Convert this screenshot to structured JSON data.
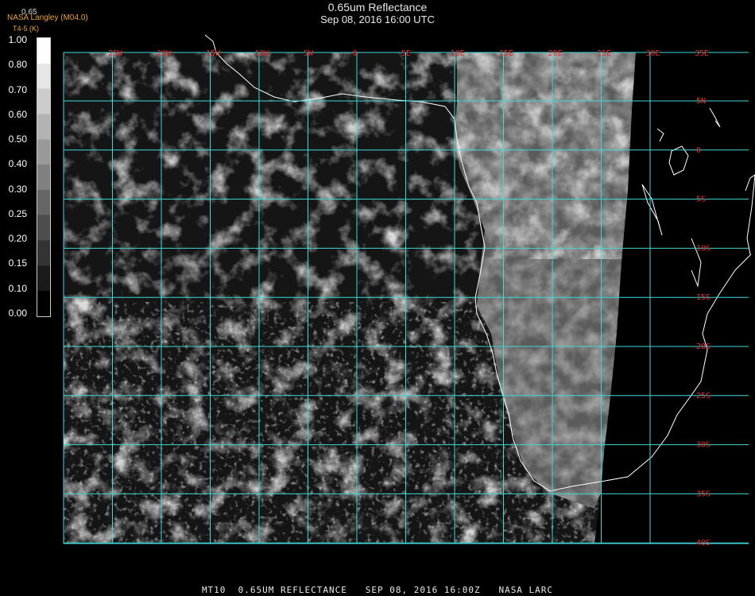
{
  "header": {
    "title": "0.65um Reflectance",
    "subtitle": "Sep 08, 2016 16:00 UTC",
    "brand": "NASA Langley (M04.0)",
    "brand_sub": "T4-5 (K)",
    "band_label": "0.65"
  },
  "colorbar": {
    "labels": [
      "1.00",
      "0.80",
      "0.70",
      "0.60",
      "0.50",
      "0.40",
      "0.30",
      "0.25",
      "0.20",
      "0.15",
      "0.10",
      "0.00"
    ]
  },
  "map": {
    "longitude_labels": [
      "25W",
      "20W",
      "15W",
      "10W",
      "5W",
      "0",
      "5E",
      "10E",
      "15E",
      "20E",
      "25E",
      "30E",
      "35E"
    ],
    "latitude_labels": [
      "5N",
      "0",
      "5S",
      "10S",
      "15S",
      "20S",
      "25S",
      "30S",
      "35S",
      "40S"
    ],
    "grid_color": "#40d8d8",
    "label_color": "#e03030"
  },
  "footer": {
    "text": "MT10  0.65UM REFLECTANCE   SEP 08, 2016 16:00Z   NASA LARC"
  }
}
